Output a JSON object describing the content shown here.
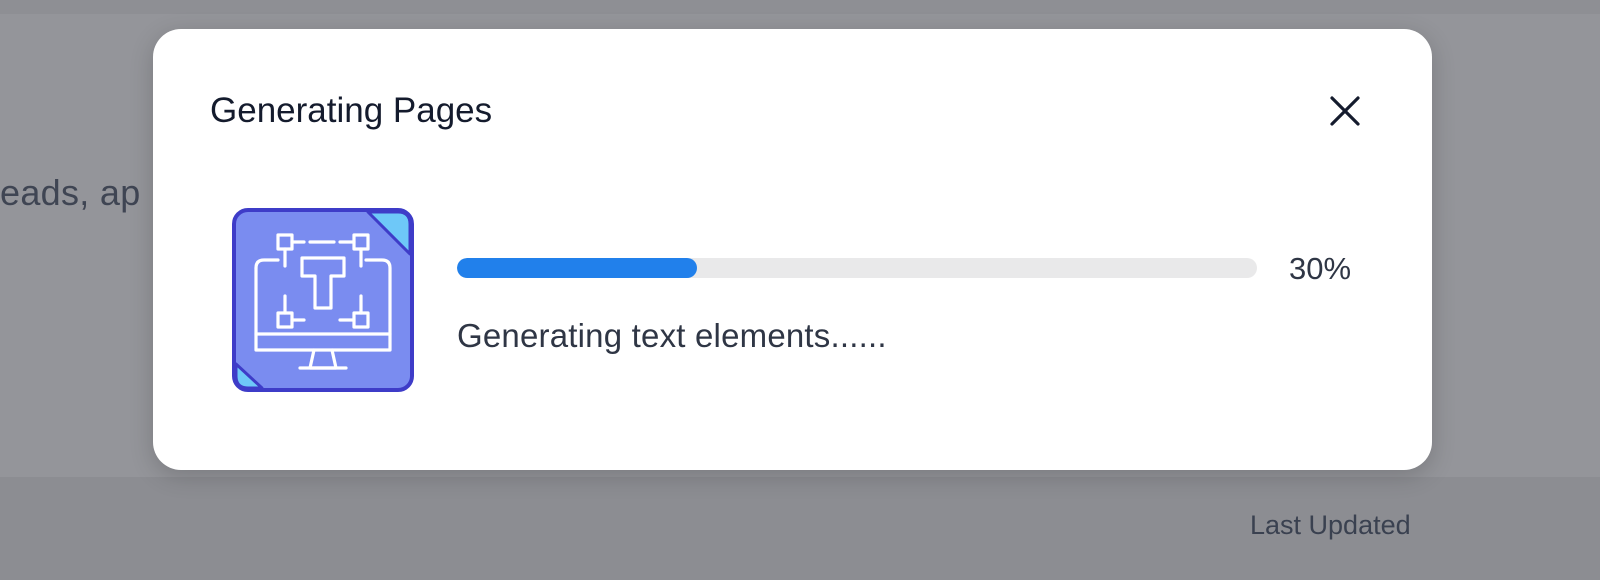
{
  "background": {
    "partial_text": "eads, ap",
    "footer_column_label": "Last Updated"
  },
  "modal": {
    "title": "Generating Pages",
    "close_icon": "close-icon",
    "illustration_icon": "monitor-text-layout-icon",
    "progress": {
      "value": 0.3,
      "label": "30%",
      "color": "#2180eb"
    },
    "status_text": "Generating text elements......"
  }
}
